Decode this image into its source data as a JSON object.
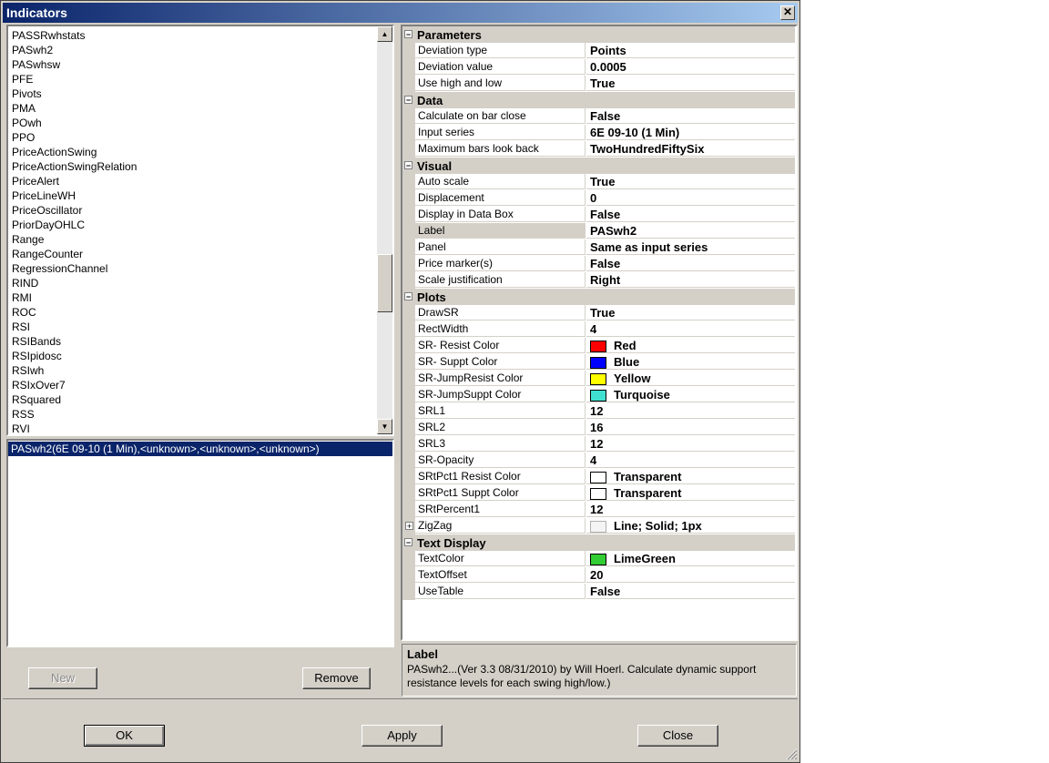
{
  "window": {
    "title": "Indicators"
  },
  "indicator_list": {
    "items": [
      "PASSRwhstats",
      "PASwh2",
      "PASwhsw",
      "PFE",
      "Pivots",
      "PMA",
      "POwh",
      "PPO",
      "PriceActionSwing",
      "PriceActionSwingRelation",
      "PriceAlert",
      "PriceLineWH",
      "PriceOscillator",
      "PriorDayOHLC",
      "Range",
      "RangeCounter",
      "RegressionChannel",
      "RIND",
      "RMI",
      "ROC",
      "RSI",
      "RSIBands",
      "RSIpidosc",
      "RSIwh",
      "RSIxOver7",
      "RSquared",
      "RSS",
      "RVI"
    ]
  },
  "applied_list": {
    "items": [
      "PASwh2(6E 09-10 (1 Min),<unknown>,<unknown>,<unknown>)"
    ]
  },
  "left_buttons": {
    "new": "New",
    "remove": "Remove"
  },
  "properties": {
    "categories": [
      {
        "name": "Parameters",
        "rows": [
          {
            "name": "Deviation type",
            "value": "Points"
          },
          {
            "name": "Deviation value",
            "value": "0.0005"
          },
          {
            "name": "Use high and low",
            "value": "True"
          }
        ]
      },
      {
        "name": "Data",
        "rows": [
          {
            "name": "Calculate on bar close",
            "value": "False"
          },
          {
            "name": "Input series",
            "value": "6E 09-10 (1 Min)"
          },
          {
            "name": "Maximum bars look back",
            "value": "TwoHundredFiftySix"
          }
        ]
      },
      {
        "name": "Visual",
        "rows": [
          {
            "name": "Auto scale",
            "value": "True"
          },
          {
            "name": "Displacement",
            "value": "0"
          },
          {
            "name": "Display in Data Box",
            "value": "False"
          },
          {
            "name": "Label",
            "value": "PASwh2",
            "selected": true
          },
          {
            "name": "Panel",
            "value": "Same as input series"
          },
          {
            "name": "Price marker(s)",
            "value": "False"
          },
          {
            "name": "Scale justification",
            "value": "Right"
          }
        ]
      },
      {
        "name": "Plots",
        "rows": [
          {
            "name": "DrawSR",
            "value": "True"
          },
          {
            "name": "RectWidth",
            "value": "4"
          },
          {
            "name": "SR- Resist Color",
            "value": "Red",
            "swatch": "#ff0000"
          },
          {
            "name": "SR- Suppt Color",
            "value": "Blue",
            "swatch": "#0000ff"
          },
          {
            "name": "SR-JumpResist Color",
            "value": "Yellow",
            "swatch": "#ffff00"
          },
          {
            "name": "SR-JumpSuppt Color",
            "value": "Turquoise",
            "swatch": "#40e0d0"
          },
          {
            "name": "SRL1",
            "value": "12"
          },
          {
            "name": "SRL2",
            "value": "16"
          },
          {
            "name": "SRL3",
            "value": "12"
          },
          {
            "name": "SR-Opacity",
            "value": "4"
          },
          {
            "name": "SRtPct1 Resist Color",
            "value": "Transparent",
            "swatch": "#ffffff"
          },
          {
            "name": "SRtPct1 Suppt Color",
            "value": "Transparent",
            "swatch": "#ffffff"
          },
          {
            "name": "SRtPercent1",
            "value": "12"
          },
          {
            "name": "ZigZag",
            "value": "Line; Solid; 1px",
            "swatch": "#f4f4f4",
            "expandable": true
          }
        ]
      },
      {
        "name": "Text Display",
        "rows": [
          {
            "name": "TextColor",
            "value": "LimeGreen",
            "swatch": "#32cd32"
          },
          {
            "name": "TextOffset",
            "value": "20"
          },
          {
            "name": "UseTable",
            "value": "False"
          }
        ]
      }
    ]
  },
  "description": {
    "title": "Label",
    "text": "PASwh2...(Ver 3.3  08/31/2010)  by Will Hoerl.  Calculate dynamic support resistance levels for each swing high/low.)"
  },
  "footer": {
    "ok": "OK",
    "apply": "Apply",
    "close": "Close"
  },
  "icons": {
    "close": "close-icon",
    "scroll_up": "scroll-up-icon",
    "scroll_down": "scroll-down-icon",
    "expand": "expand-icon",
    "collapse": "collapse-icon",
    "resize": "resize-grip-icon"
  }
}
